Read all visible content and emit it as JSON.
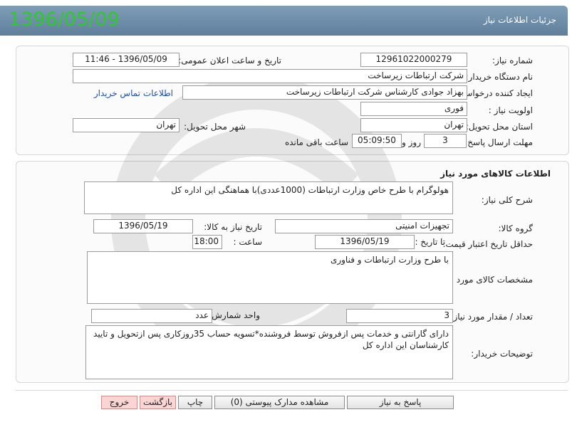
{
  "stamp_date": "1396/05/09",
  "header": {
    "title": "جزئیات اطلاعات نیاز"
  },
  "need": {
    "number_label": "شماره نیاز:",
    "number_value": "12961022000279",
    "announce_label": "تاریخ و ساعت اعلان عمومی:",
    "announce_value": "1396/05/09 - 11:46",
    "buyer_label": "نام دستگاه خریدار:",
    "buyer_value": "شرکت ارتباطات زیرساخت",
    "creator_label": "ایجاد کننده درخواست:",
    "creator_value": "بهزاد جوادی کارشناس شرکت ارتباطات زیرساخت",
    "contact_link": "اطلاعات تماس خریدار",
    "priority_label": "اولویت نیاز :",
    "priority_value": "فوری",
    "province_label": "استان محل تحویل:",
    "province_value": "تهران",
    "city_label": "شهر محل تحویل:",
    "city_value": "تهران",
    "deadline_label": "مهلت ارسال پاسخ:",
    "days_value": "3",
    "days_suffix": "روز و",
    "time_value": "05:09:50",
    "time_suffix": "ساعت باقی مانده"
  },
  "goods": {
    "section_title": "اطلاعات کالاهای مورد نیاز",
    "summary_label": "شرح کلی نیاز:",
    "summary_value": "هولوگرام با طرح خاص وزارت ارتباطات (1000عددی)با هماهنگی این اداره کل",
    "group_label": "گروه کالا:",
    "group_value": "تجهیزات امنیتی",
    "needdate_label": "تاریخ نیاز به کالا:",
    "needdate_value": "1396/05/19",
    "validity_label": "حداقل تاریخ اعتبار قیمت:",
    "until_label": "تا تاریخ :",
    "until_value": "1396/05/19",
    "hour_label": "ساعت :",
    "hour_value": "18:00",
    "spec_label": "مشخصات کالای مورد نیاز:",
    "spec_value": "با طرح وزارت ارتباطات و فناوری",
    "qty_label": "تعداد / مقدار مورد نیاز:",
    "qty_value": "3",
    "unit_label": "واحد شمارش:",
    "unit_value": "عدد",
    "notes_label": "توضیحات خریدار:",
    "notes_value": "دارای گارانتی و خدمات پس ازفروش توسط فروشنده*تسویه حساب 35روزکاری پس ازتحویل و تایید کارشناسان این اداره کل"
  },
  "buttons": {
    "reply": "پاسخ به نیاز",
    "attachments": "مشاهده مدارک پیوستی (0)",
    "print": "چاپ",
    "back": "بازگشت",
    "exit": "خروج"
  },
  "colors": {
    "header": "#6f8ea9",
    "stamp": "#2ec92e",
    "link": "#1a4fb5",
    "danger_button": "#fbd4d4"
  }
}
